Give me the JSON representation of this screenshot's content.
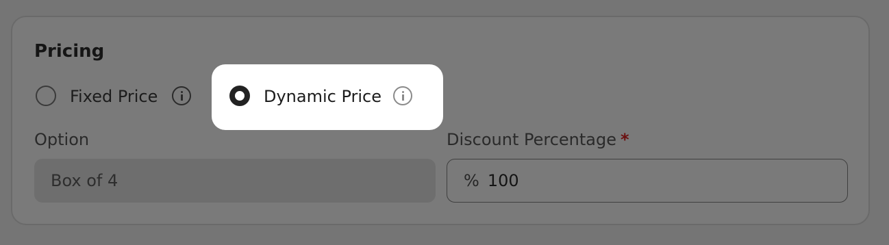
{
  "pricing": {
    "title": "Pricing",
    "options": [
      {
        "label": "Fixed Price",
        "selected": false,
        "icon": "info-icon"
      },
      {
        "label": "Dynamic Price",
        "selected": true,
        "icon": "info-icon"
      }
    ]
  },
  "option_field": {
    "label": "Option",
    "value": "Box of 4"
  },
  "discount_field": {
    "label": "Discount Percentage",
    "required_marker": "*",
    "prefix": "%",
    "value": "100"
  },
  "colors": {
    "overlay": "#757575",
    "highlight": "#ffffff",
    "required": "#6b1010"
  }
}
